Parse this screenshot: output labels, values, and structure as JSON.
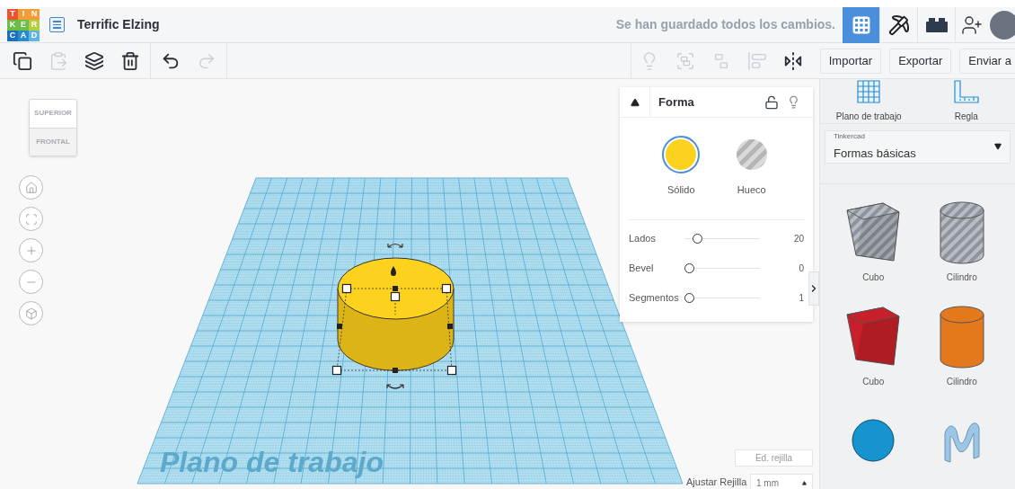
{
  "header": {
    "logo": [
      {
        "letter": "T",
        "color": "#e9552f"
      },
      {
        "letter": "I",
        "color": "#f29c37"
      },
      {
        "letter": "N",
        "color": "#f29c37"
      },
      {
        "letter": "K",
        "color": "#6bbd45"
      },
      {
        "letter": "E",
        "color": "#6bbd45"
      },
      {
        "letter": "R",
        "color": "#b5cf3c"
      },
      {
        "letter": "C",
        "color": "#1d70b8"
      },
      {
        "letter": "A",
        "color": "#2a8ccd"
      },
      {
        "letter": "D",
        "color": "#5fb4e0"
      }
    ],
    "title": "Terrific Elzing",
    "save_status": "Se han guardado todos los cambios.",
    "views": [
      {
        "kind": "grid",
        "selected": true
      },
      {
        "kind": "pickaxe",
        "selected": false
      },
      {
        "kind": "brick",
        "selected": false
      }
    ]
  },
  "toolbar": {
    "left": [
      {
        "kind": "copy",
        "disabled": false
      },
      {
        "kind": "paste",
        "disabled": true
      },
      {
        "kind": "duplicate",
        "disabled": false
      },
      {
        "kind": "delete",
        "disabled": false
      },
      {
        "kind": "undo",
        "disabled": false
      },
      {
        "kind": "redo",
        "disabled": true
      }
    ],
    "right": [
      {
        "kind": "hint",
        "disabled": true
      },
      {
        "kind": "group",
        "disabled": true
      },
      {
        "kind": "ungroup",
        "disabled": true
      },
      {
        "kind": "align",
        "disabled": true
      },
      {
        "kind": "mirror",
        "disabled": false
      }
    ],
    "buttons": [
      "Importar",
      "Exportar",
      "Enviar a"
    ]
  },
  "view_cube": {
    "top": "SUPERIOR",
    "front": "FRONTAL"
  },
  "workplane_label": "Plano de trabajo",
  "shape_panel": {
    "title": "Forma",
    "locked": false,
    "modes": [
      {
        "label": "Sólido",
        "kind": "solid",
        "selected": true,
        "color": "#fcd21e"
      },
      {
        "label": "Hueco",
        "kind": "hole",
        "selected": false,
        "color": "#b5b5b5"
      }
    ],
    "sliders": [
      {
        "label": "Lados",
        "level": 0.13,
        "reading": "20"
      },
      {
        "label": "Bevel",
        "level": 0,
        "reading": "0"
      },
      {
        "label": "Segmentos",
        "level": 0,
        "reading": "1"
      }
    ]
  },
  "grid_controls": {
    "edit_button": "Ed. rejilla",
    "snap_label": "Ajustar Rejilla",
    "snap_value": "1 mm"
  },
  "library": {
    "tools": [
      "Plano de trabajo",
      "Regla"
    ],
    "category_source": "Tinkercad",
    "category": "Formas básicas",
    "shapes": [
      {
        "kind": "box",
        "hole": true,
        "color": "#b8bcc4",
        "label": "Cubo"
      },
      {
        "kind": "cylinder",
        "hole": true,
        "color": "#b8bcc4",
        "label": "Cilindro"
      },
      {
        "kind": "box",
        "hole": false,
        "color": "#c8202a",
        "label": "Cubo"
      },
      {
        "kind": "cylinder",
        "hole": false,
        "color": "#e4781c",
        "label": "Cilindro"
      },
      {
        "kind": "sphere",
        "color": "#1594cf"
      },
      {
        "kind": "scribble",
        "color": "#9cc6e6"
      }
    ]
  }
}
